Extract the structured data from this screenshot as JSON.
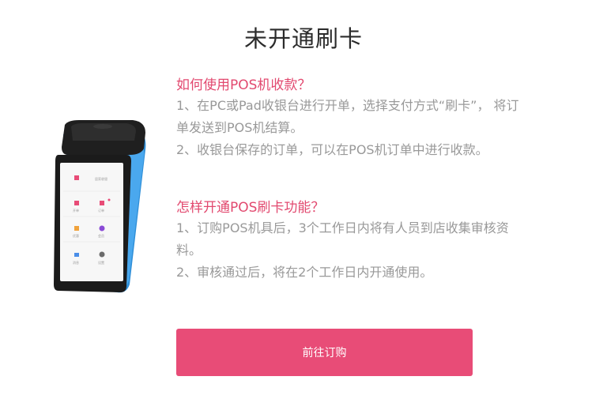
{
  "page_title": "未开通刷卡",
  "sections": [
    {
      "question": "如何使用POS机收款？",
      "lines": [
        "1、在PC或Pad收银台进行开单，选择支付方式“刷卡”， 将订",
        "单发送到POS机结算。",
        "2、收银台保存的订单，可以在POS机订单中进行收款。"
      ]
    },
    {
      "question": "怎样开通POS刷卡功能？",
      "lines": [
        "1、订购POS机具后，3个工作日内将有人员到店收集审核资",
        "料。",
        "2、审核通过后，将在2个工作日内开通使用。"
      ]
    }
  ],
  "button_label": "前往订购",
  "colors": {
    "accent": "#e84c77",
    "question": "#e2496f",
    "body_text": "#999999",
    "title": "#2b2b2b"
  }
}
